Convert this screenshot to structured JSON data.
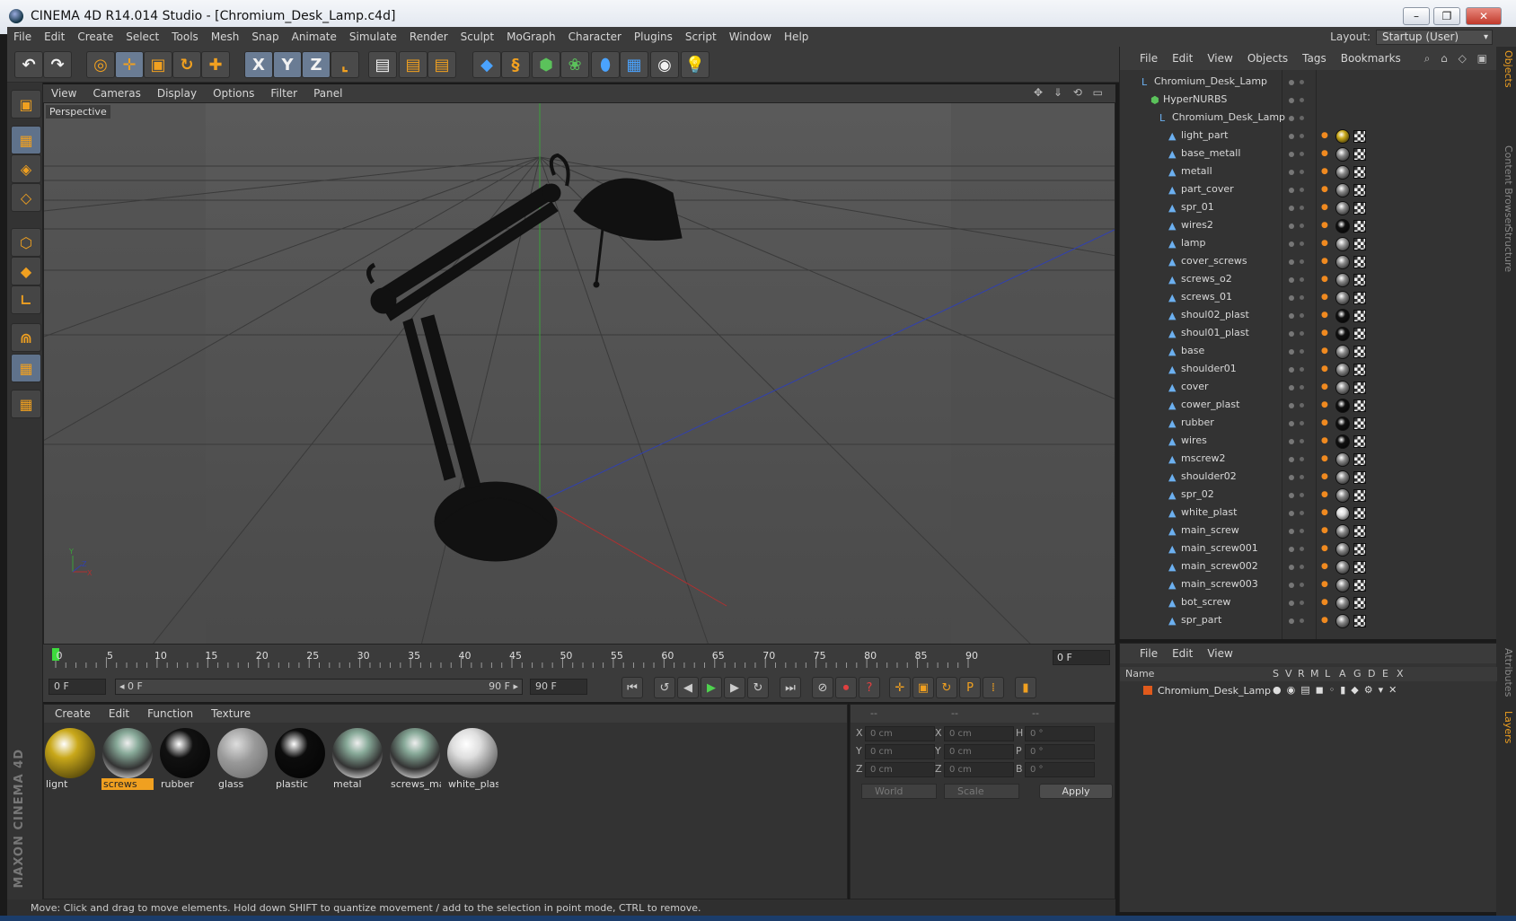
{
  "window": {
    "title": "CINEMA 4D R14.014 Studio - [Chromium_Desk_Lamp.c4d]",
    "buttons": [
      "–",
      "❐",
      "✕"
    ]
  },
  "menubar": {
    "items": [
      "File",
      "Edit",
      "Create",
      "Select",
      "Tools",
      "Mesh",
      "Snap",
      "Animate",
      "Simulate",
      "Render",
      "Sculpt",
      "MoGraph",
      "Character",
      "Plugins",
      "Script",
      "Window",
      "Help"
    ],
    "layout_label": "Layout:",
    "layout_value": "Startup (User)"
  },
  "toolbar": {
    "buttons": [
      {
        "name": "undo-button",
        "glyph": "↶",
        "style": "white"
      },
      {
        "name": "redo-button",
        "glyph": "↷",
        "style": "white"
      },
      {
        "name": "live-selection-button",
        "glyph": "◎",
        "style": "orange"
      },
      {
        "name": "move-button",
        "glyph": "✛",
        "style": "orange",
        "active": true
      },
      {
        "name": "scale-button",
        "glyph": "▣",
        "style": "orange"
      },
      {
        "name": "rotate-button",
        "glyph": "↻",
        "style": "orange"
      },
      {
        "name": "last-tool-button",
        "glyph": "✚",
        "style": "orange"
      },
      {
        "name": "lock-x-button",
        "glyph": "X",
        "style": "white",
        "active": true
      },
      {
        "name": "lock-y-button",
        "glyph": "Y",
        "style": "white",
        "active": true
      },
      {
        "name": "lock-z-button",
        "glyph": "Z",
        "style": "white",
        "active": true
      },
      {
        "name": "coordinate-system-button",
        "glyph": "⌞",
        "style": "orange"
      },
      {
        "name": "render-view-button",
        "glyph": "▤",
        "style": "white"
      },
      {
        "name": "render-picture-viewer-button",
        "glyph": "▤",
        "style": "orange"
      },
      {
        "name": "render-settings-button",
        "glyph": "▤",
        "style": "orange"
      },
      {
        "name": "cube-button",
        "glyph": "◆",
        "style": "blue"
      },
      {
        "name": "spline-button",
        "glyph": "§",
        "style": "orange"
      },
      {
        "name": "subdivision-button",
        "glyph": "⬢",
        "style": "green"
      },
      {
        "name": "mograph-button",
        "glyph": "❀",
        "style": "green"
      },
      {
        "name": "deformer-button",
        "glyph": "⬮",
        "style": "blue"
      },
      {
        "name": "scene-button",
        "glyph": "▦",
        "style": "blue"
      },
      {
        "name": "camera-button",
        "glyph": "◉",
        "style": "white"
      },
      {
        "name": "light-button",
        "glyph": "💡",
        "style": "white"
      }
    ]
  },
  "left_tools": [
    "▣",
    "▦",
    "◈",
    "◇",
    "⬡",
    "◆",
    "∟",
    "⋒",
    "▦",
    "▦"
  ],
  "viewport": {
    "menu": [
      "View",
      "Cameras",
      "Display",
      "Options",
      "Filter",
      "Panel"
    ],
    "label": "Perspective",
    "nav_icons": "✥ ⇓ ⟲ ▭"
  },
  "timeline": {
    "ticks": [
      "0",
      "5",
      "10",
      "15",
      "20",
      "25",
      "30",
      "35",
      "40",
      "45",
      "50",
      "55",
      "60",
      "65",
      "70",
      "75",
      "80",
      "85",
      "90"
    ],
    "current_frame": "0 F"
  },
  "transport": {
    "start_field": "0 F",
    "range_start": "◂ 0 F",
    "range_end": "90 F ▸",
    "end_field": "90 F",
    "buttons": [
      {
        "name": "go-to-start-button",
        "glyph": "⏮",
        "style": ""
      },
      {
        "name": "previous-key-button",
        "glyph": "↺",
        "style": ""
      },
      {
        "name": "previous-frame-button",
        "glyph": "◀",
        "style": ""
      },
      {
        "name": "play-button",
        "glyph": "▶",
        "style": "play"
      },
      {
        "name": "next-frame-button",
        "glyph": "▶",
        "style": ""
      },
      {
        "name": "next-key-button",
        "glyph": "↻",
        "style": ""
      },
      {
        "name": "go-to-end-button",
        "glyph": "⏭",
        "style": ""
      },
      {
        "name": "record-keys-button",
        "glyph": "⊘",
        "style": ""
      },
      {
        "name": "auto-keying-button",
        "glyph": "⏺",
        "style": "rec"
      },
      {
        "name": "keyframe-selection-button",
        "glyph": "?",
        "style": "rec"
      },
      {
        "name": "position-key-button",
        "glyph": "✛",
        "style": "orange"
      },
      {
        "name": "scale-key-button",
        "glyph": "▣",
        "style": "orange"
      },
      {
        "name": "rotation-key-button",
        "glyph": "↻",
        "style": "orange"
      },
      {
        "name": "parameter-key-button",
        "glyph": "P",
        "style": "orange"
      },
      {
        "name": "pla-key-button",
        "glyph": "⁞",
        "style": "orange"
      },
      {
        "name": "timeline-button",
        "glyph": "▮",
        "style": "orange"
      }
    ]
  },
  "materials": {
    "menu": [
      "Create",
      "Edit",
      "Function",
      "Texture"
    ],
    "items": [
      {
        "label": "lignt",
        "color": "#c9a81a",
        "kind": "solid"
      },
      {
        "label": "screws",
        "color": "#8a8a8a",
        "kind": "chrome",
        "selected": true
      },
      {
        "label": "rubber",
        "color": "#111111",
        "kind": "solid"
      },
      {
        "label": "glass",
        "color": "#9a9a9a",
        "kind": "glass"
      },
      {
        "label": "plastic",
        "color": "#0c0c0c",
        "kind": "solid"
      },
      {
        "label": "metal",
        "color": "#8a8a8a",
        "kind": "chrome"
      },
      {
        "label": "screws_mai",
        "color": "#8a8a8a",
        "kind": "chrome"
      },
      {
        "label": "white_plas",
        "color": "#dedede",
        "kind": "solid"
      }
    ]
  },
  "coords": {
    "headers": [
      "--",
      "--",
      "--"
    ],
    "rows": [
      {
        "a": "X",
        "av": "0 cm",
        "b": "X",
        "bv": "0 cm",
        "c": "H",
        "cv": "0 °"
      },
      {
        "a": "Y",
        "av": "0 cm",
        "b": "Y",
        "bv": "0 cm",
        "c": "P",
        "cv": "0 °"
      },
      {
        "a": "Z",
        "av": "0 cm",
        "b": "Z",
        "bv": "0 cm",
        "c": "B",
        "cv": "0 °"
      }
    ],
    "space": "World",
    "mode": "Scale",
    "apply": "Apply"
  },
  "objects": {
    "menu": [
      "File",
      "Edit",
      "View",
      "Objects",
      "Tags",
      "Bookmarks"
    ],
    "tree": [
      {
        "name": "Chromium_Desk_Lamp",
        "level": 0,
        "icon": "null"
      },
      {
        "name": "HyperNURBS",
        "level": 1,
        "icon": "nurbs"
      },
      {
        "name": "Chromium_Desk_Lamp",
        "level": 2,
        "icon": "null"
      },
      {
        "name": "light_part",
        "level": 3,
        "mat": "#c9a81a"
      },
      {
        "name": "base_metall",
        "level": 3,
        "mat": "#8a8a8a"
      },
      {
        "name": "metall",
        "level": 3,
        "mat": "#8a8a8a"
      },
      {
        "name": "part_cover",
        "level": 3,
        "mat": "#8a8a8a"
      },
      {
        "name": "spr_01",
        "level": 3,
        "mat": "#8a8a8a"
      },
      {
        "name": "wires2",
        "level": 3,
        "mat": "#111111"
      },
      {
        "name": "lamp",
        "level": 3,
        "mat": "#9a9a9a"
      },
      {
        "name": "cover_screws",
        "level": 3,
        "mat": "#8a8a8a"
      },
      {
        "name": "screws_o2",
        "level": 3,
        "mat": "#8a8a8a"
      },
      {
        "name": "screws_01",
        "level": 3,
        "mat": "#8a8a8a"
      },
      {
        "name": "shoul02_plast",
        "level": 3,
        "mat": "#111111"
      },
      {
        "name": "shoul01_plast",
        "level": 3,
        "mat": "#111111"
      },
      {
        "name": "base",
        "level": 3,
        "mat": "#8a8a8a"
      },
      {
        "name": "shoulder01",
        "level": 3,
        "mat": "#8a8a8a"
      },
      {
        "name": "cover",
        "level": 3,
        "mat": "#8a8a8a"
      },
      {
        "name": "cower_plast",
        "level": 3,
        "mat": "#111111"
      },
      {
        "name": "rubber",
        "level": 3,
        "mat": "#111111"
      },
      {
        "name": "wires",
        "level": 3,
        "mat": "#111111"
      },
      {
        "name": "mscrew2",
        "level": 3,
        "mat": "#8a8a8a"
      },
      {
        "name": "shoulder02",
        "level": 3,
        "mat": "#8a8a8a"
      },
      {
        "name": "spr_02",
        "level": 3,
        "mat": "#8a8a8a"
      },
      {
        "name": "white_plast",
        "level": 3,
        "mat": "#dedede"
      },
      {
        "name": "main_screw",
        "level": 3,
        "mat": "#8a8a8a"
      },
      {
        "name": "main_screw001",
        "level": 3,
        "mat": "#8a8a8a"
      },
      {
        "name": "main_screw002",
        "level": 3,
        "mat": "#8a8a8a"
      },
      {
        "name": "main_screw003",
        "level": 3,
        "mat": "#8a8a8a"
      },
      {
        "name": "bot_screw",
        "level": 3,
        "mat": "#8a8a8a"
      },
      {
        "name": "spr_part",
        "level": 3,
        "mat": "#8a8a8a"
      }
    ]
  },
  "layers": {
    "menu": [
      "File",
      "Edit",
      "View"
    ],
    "columns": [
      "Name",
      "S",
      "V",
      "R",
      "M",
      "L",
      "A",
      "G",
      "D",
      "E",
      "X"
    ],
    "rows": [
      {
        "name": "Chromium_Desk_Lamp",
        "color": "#e05a1c"
      }
    ]
  },
  "side_tabs": [
    {
      "label": "Objects",
      "active": true
    },
    {
      "label": "Content Browser",
      "active": false
    },
    {
      "label": "Structure",
      "active": false
    },
    {
      "label": "Attributes",
      "active": false
    },
    {
      "label": "Layers",
      "active": true
    }
  ],
  "status": "Move: Click and drag to move elements. Hold down SHIFT to quantize movement / add to the selection in point mode, CTRL to remove.",
  "brand": "MAXON CINEMA 4D"
}
